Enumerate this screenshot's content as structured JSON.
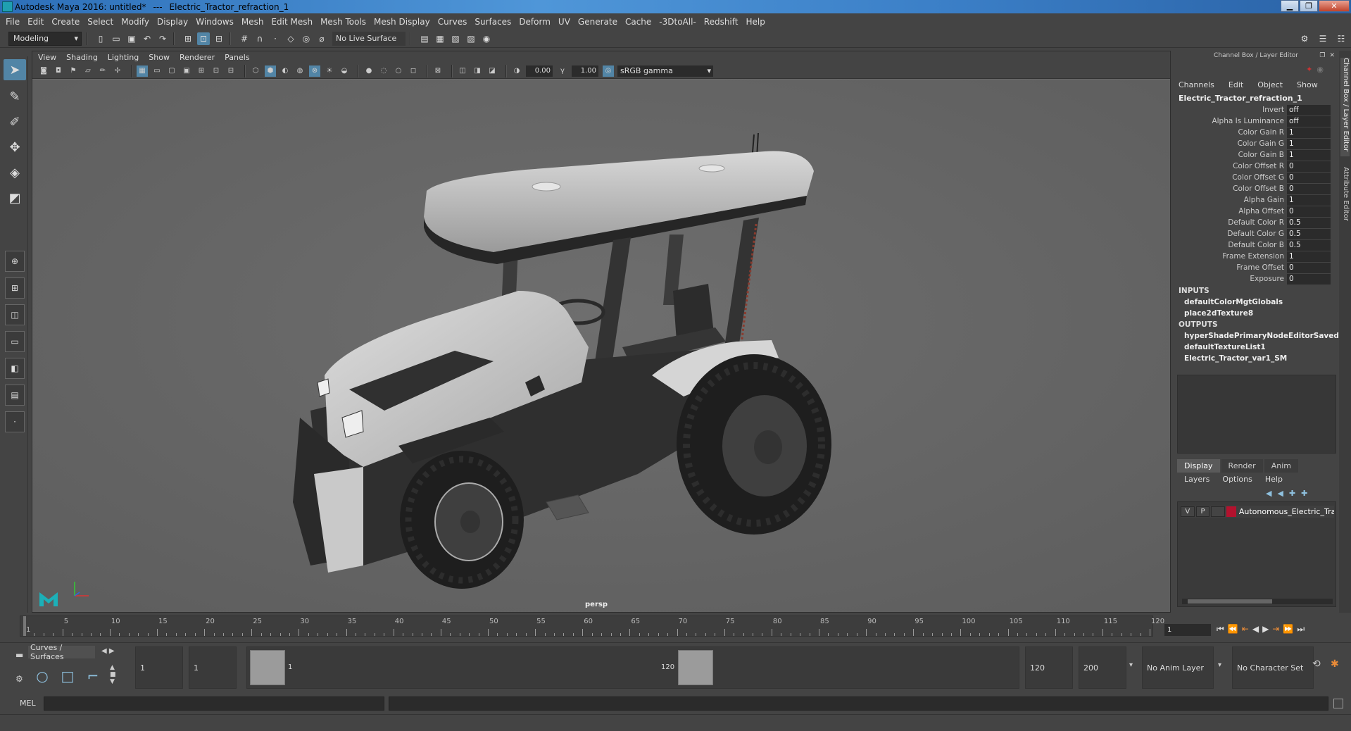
{
  "window": {
    "app_title": "Autodesk Maya 2016: untitled*",
    "separator": "---",
    "node_title": "Electric_Tractor_refraction_1"
  },
  "menubar": [
    "File",
    "Edit",
    "Create",
    "Select",
    "Modify",
    "Display",
    "Windows",
    "Mesh",
    "Edit Mesh",
    "Mesh Tools",
    "Mesh Display",
    "Curves",
    "Surfaces",
    "Deform",
    "UV",
    "Generate",
    "Cache",
    "-3DtoAll-",
    "Redshift",
    "Help"
  ],
  "statusline": {
    "mode": "Modeling",
    "live_surface": "No Live Surface"
  },
  "panel": {
    "menus": [
      "View",
      "Shading",
      "Lighting",
      "Show",
      "Renderer",
      "Panels"
    ],
    "exposure": "0.00",
    "gamma": "1.00",
    "color_space": "sRGB gamma",
    "camera_label": "persp"
  },
  "channelbox": {
    "header": "Channel Box / Layer Editor",
    "menus": [
      "Channels",
      "Edit",
      "Object",
      "Show"
    ],
    "node": "Electric_Tractor_refraction_1",
    "attributes": [
      {
        "name": "Invert",
        "value": "off"
      },
      {
        "name": "Alpha Is Luminance",
        "value": "off"
      },
      {
        "name": "Color Gain R",
        "value": "1"
      },
      {
        "name": "Color Gain G",
        "value": "1"
      },
      {
        "name": "Color Gain B",
        "value": "1"
      },
      {
        "name": "Color Offset R",
        "value": "0"
      },
      {
        "name": "Color Offset G",
        "value": "0"
      },
      {
        "name": "Color Offset B",
        "value": "0"
      },
      {
        "name": "Alpha Gain",
        "value": "1"
      },
      {
        "name": "Alpha Offset",
        "value": "0"
      },
      {
        "name": "Default Color R",
        "value": "0.5"
      },
      {
        "name": "Default Color G",
        "value": "0.5"
      },
      {
        "name": "Default Color B",
        "value": "0.5"
      },
      {
        "name": "Frame Extension",
        "value": "1"
      },
      {
        "name": "Frame Offset",
        "value": "0"
      },
      {
        "name": "Exposure",
        "value": "0"
      }
    ],
    "inputs_label": "INPUTS",
    "inputs": [
      "defaultColorMgtGlobals",
      "place2dTexture8"
    ],
    "outputs_label": "OUTPUTS",
    "outputs": [
      "hyperShadePrimaryNodeEditorSavedT...",
      "defaultTextureList1",
      "Electric_Tractor_var1_SM"
    ]
  },
  "layers": {
    "tabs": [
      "Display",
      "Render",
      "Anim"
    ],
    "active_tab": "Display",
    "menus": [
      "Layers",
      "Options",
      "Help"
    ],
    "row": {
      "v": "V",
      "p": "P",
      "name": "Autonomous_Electric_Tra",
      "color": "#b3122e"
    }
  },
  "side_tabs": [
    "Channel Box / Layer Editor",
    "Attribute Editor"
  ],
  "timeslider": {
    "ticks": [
      1,
      5,
      10,
      15,
      20,
      25,
      30,
      35,
      40,
      45,
      50,
      55,
      60,
      65,
      70,
      75,
      80,
      85,
      90,
      95,
      100,
      105,
      110,
      115,
      120
    ],
    "current_frame": "1"
  },
  "range": {
    "shelf_tab": "Curves / Surfaces",
    "start_time": "1",
    "playback_start": "1",
    "range_start_label": "1",
    "range_end_label": "120",
    "playback_end": "120",
    "end_time": "200",
    "anim_layer": "No Anim Layer",
    "character_set": "No Character Set"
  },
  "cmdline": {
    "label": "MEL"
  },
  "colors": {
    "accent": "#5285a6",
    "layer_red": "#b3122e",
    "background": "#444444",
    "viewport": "#666666"
  }
}
